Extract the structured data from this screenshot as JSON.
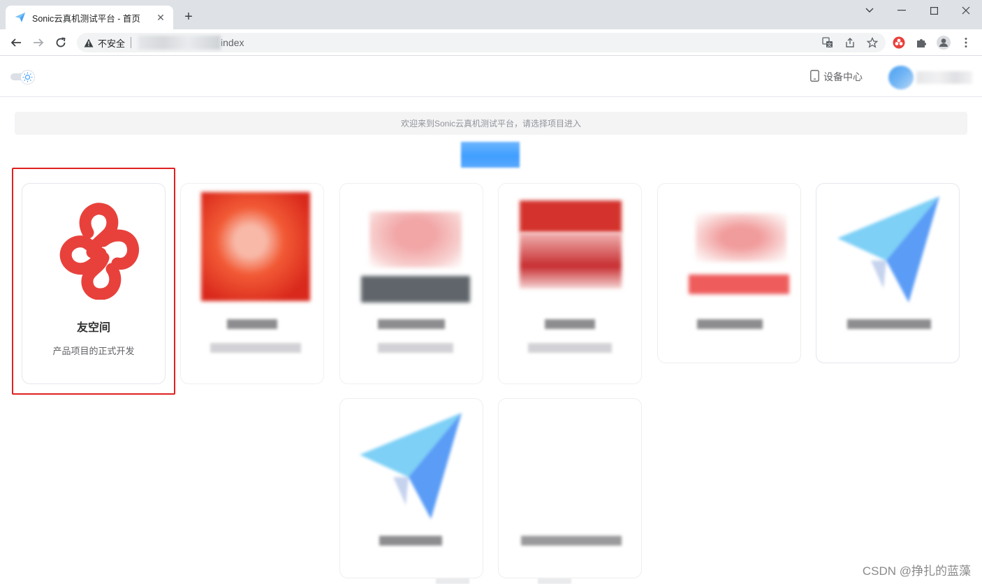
{
  "browser": {
    "tab_title": "Sonic云真机测试平台 - 首页",
    "new_tab_symbol": "+",
    "address": {
      "security_label": "不安全",
      "path": "index"
    }
  },
  "header": {
    "device_center_label": "设备中心"
  },
  "welcome_text": "欢迎来到Sonic云真机测试平台，请选择项目进入",
  "projects": [
    {
      "name": "友空间",
      "description": "产品项目的正式开发",
      "icon": "yonyou-logo",
      "selected": true
    },
    {
      "name": "",
      "description": "",
      "icon": "blurred-red-shield"
    },
    {
      "name": "",
      "description": "",
      "icon": "blurred-red-bag"
    },
    {
      "name": "",
      "description": "",
      "icon": "blurred-red-calendar"
    },
    {
      "name": "",
      "description": "",
      "icon": "blurred-pink-bag"
    },
    {
      "name": "",
      "description": "",
      "icon": "blurred-blue-paperplane"
    },
    {
      "name": "",
      "description": "",
      "icon": "blurred-blue-paperplane"
    },
    {
      "name": "",
      "description": "",
      "icon": "blank"
    }
  ],
  "watermark": "CSDN @挣扎的蓝藻",
  "colors": {
    "accent": "#409eff",
    "selection_outline": "#e02020",
    "logo_red": "#e8413c"
  }
}
